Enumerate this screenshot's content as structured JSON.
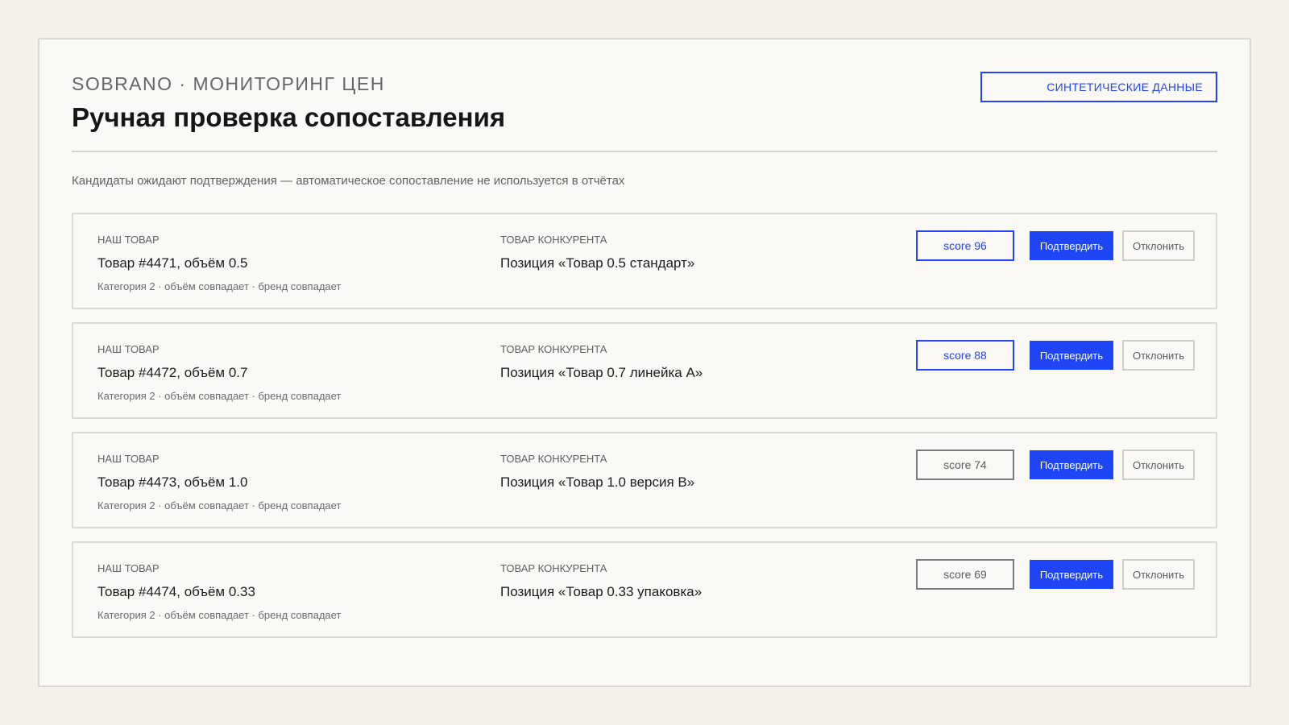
{
  "header": {
    "kicker": "SOBRANO · МОНИТОРИНГ ЦЕН",
    "title": "Ручная проверка сопоставления",
    "badge": "СИНТЕТИЧЕСКИЕ ДАННЫЕ"
  },
  "subtitle": "Кандидаты ожидают подтверждения — автоматическое сопоставление не используется в отчётах",
  "labels": {
    "ours": "НАШ ТОВАР",
    "theirs": "ТОВАР КОНКУРЕНТА",
    "confirm": "Подтвердить",
    "reject": "Отклонить"
  },
  "colors": {
    "accent": "#1f45f5",
    "neutral_border": "#7a7a7a"
  },
  "matches": [
    {
      "ours": "Товар #4471, объём 0.5",
      "meta": "Категория 2 · объём совпадает · бренд совпадает",
      "theirs": "Позиция «Товар 0.5 стандарт»",
      "score": "score 96",
      "score_value": 96,
      "highlight": true
    },
    {
      "ours": "Товар #4472, объём 0.7",
      "meta": "Категория 2 · объём совпадает · бренд совпадает",
      "theirs": "Позиция «Товар 0.7 линейка A»",
      "score": "score 88",
      "score_value": 88,
      "highlight": true
    },
    {
      "ours": "Товар #4473, объём 1.0",
      "meta": "Категория 2 · объём совпадает · бренд совпадает",
      "theirs": "Позиция «Товар 1.0 версия B»",
      "score": "score 74",
      "score_value": 74,
      "highlight": false
    },
    {
      "ours": "Товар #4474, объём 0.33",
      "meta": "Категория 2 · объём совпадает · бренд совпадает",
      "theirs": "Позиция «Товар 0.33 упаковка»",
      "score": "score 69",
      "score_value": 69,
      "highlight": false
    }
  ]
}
